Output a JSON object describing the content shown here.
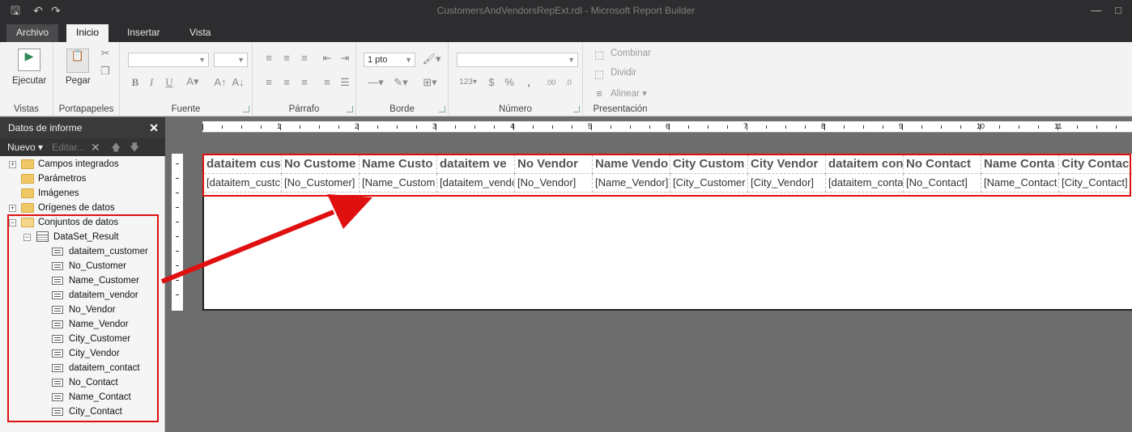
{
  "window": {
    "title": "CustomersAndVendorsRepExt.rdl - Microsoft Report Builder"
  },
  "tabs": [
    "Archivo",
    "Inicio",
    "Insertar",
    "Vista"
  ],
  "ribbon": {
    "groups": [
      "Vistas",
      "Portapapeles",
      "Fuente",
      "Párrafo",
      "Borde",
      "Número",
      "Presentación"
    ],
    "run_label": "Ejecutar",
    "paste_label": "Pegar",
    "border_size": "1 pto",
    "merge_label": "Combinar",
    "split_label": "Dividir",
    "align_label": "Alinear"
  },
  "panel": {
    "title": "Datos de informe",
    "new_label": "Nuevo",
    "edit_label": "Editar...",
    "top_nodes": [
      "Campos integrados",
      "Parámetros",
      "Imágenes",
      "Orígenes de datos",
      "Conjuntos de datos"
    ],
    "dataset": "DataSet_Result",
    "fields": [
      "dataitem_customer",
      "No_Customer",
      "Name_Customer",
      "dataitem_vendor",
      "No_Vendor",
      "Name_Vendor",
      "City_Customer",
      "City_Vendor",
      "dataitem_contact",
      "No_Contact",
      "Name_Contact",
      "City_Contact"
    ]
  },
  "ruler": {
    "numbers": [
      "1",
      "2",
      "3",
      "4",
      "5",
      "6",
      "7",
      "8",
      "9",
      "10",
      "11"
    ]
  },
  "table": {
    "headers": [
      "dataitem cus",
      "No Custome",
      "Name Custo",
      "dataitem ve",
      "No Vendor",
      "Name Vendo",
      "City Custom",
      "City Vendor",
      "dataitem con",
      "No Contact",
      "Name Conta",
      "City Contac"
    ],
    "cells": [
      "[dataitem_custc",
      "[No_Customer]",
      "[Name_Custom",
      "[dataitem_vendo",
      "[No_Vendor]",
      "[Name_Vendor]",
      "[City_Customer",
      "[City_Vendor]",
      "[dataitem_conta",
      "[No_Contact]",
      "[Name_Contact",
      "[City_Contact]"
    ]
  },
  "colors": {
    "highlight": "#e01010",
    "titlebar": "#2d2d30",
    "ribbon": "#f3f3f3"
  }
}
